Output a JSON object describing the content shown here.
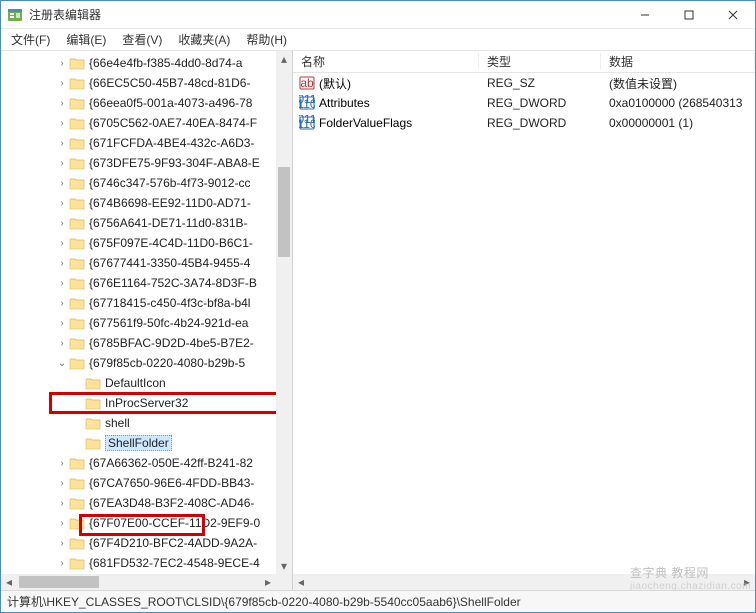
{
  "window": {
    "title": "注册表编辑器"
  },
  "menubar": {
    "file": "文件(F)",
    "edit": "编辑(E)",
    "view": "查看(V)",
    "favorites": "收藏夹(A)",
    "help": "帮助(H)"
  },
  "tree": {
    "items": [
      {
        "indent": 0,
        "exp": ">",
        "label": "{66e4e4fb-f385-4dd0-8d74-a"
      },
      {
        "indent": 0,
        "exp": ">",
        "label": "{66EC5C50-45B7-48cd-81D6-"
      },
      {
        "indent": 0,
        "exp": ">",
        "label": "{66eea0f5-001a-4073-a496-78"
      },
      {
        "indent": 0,
        "exp": ">",
        "label": "{6705C562-0AE7-40EA-8474-F"
      },
      {
        "indent": 0,
        "exp": ">",
        "label": "{671FCFDA-4BE4-432c-A6D3-"
      },
      {
        "indent": 0,
        "exp": ">",
        "label": "{673DFE75-9F93-304F-ABA8-E"
      },
      {
        "indent": 0,
        "exp": ">",
        "label": "{6746c347-576b-4f73-9012-cc"
      },
      {
        "indent": 0,
        "exp": ">",
        "label": "{674B6698-EE92-11D0-AD71-"
      },
      {
        "indent": 0,
        "exp": ">",
        "label": "{6756A641-DE71-11d0-831B-"
      },
      {
        "indent": 0,
        "exp": ">",
        "label": "{675F097E-4C4D-11D0-B6C1-"
      },
      {
        "indent": 0,
        "exp": ">",
        "label": "{67677441-3350-45B4-9455-4"
      },
      {
        "indent": 0,
        "exp": ">",
        "label": "{676E1164-752C-3A74-8D3F-B"
      },
      {
        "indent": 0,
        "exp": ">",
        "label": "{67718415-c450-4f3c-bf8a-b4l"
      },
      {
        "indent": 0,
        "exp": ">",
        "label": "{677561f9-50fc-4b24-921d-ea"
      },
      {
        "indent": 0,
        "exp": ">",
        "label": "{6785BFAC-9D2D-4be5-B7E2-"
      },
      {
        "indent": 0,
        "exp": "v",
        "label": "{679f85cb-0220-4080-b29b-5"
      },
      {
        "indent": 1,
        "exp": "",
        "label": "DefaultIcon"
      },
      {
        "indent": 1,
        "exp": "",
        "label": "InProcServer32"
      },
      {
        "indent": 1,
        "exp": "",
        "label": "shell"
      },
      {
        "indent": 1,
        "exp": "",
        "label": "ShellFolder",
        "selected": true
      },
      {
        "indent": 0,
        "exp": ">",
        "label": "{67A66362-050E-42ff-B241-82"
      },
      {
        "indent": 0,
        "exp": ">",
        "label": "{67CA7650-96E6-4FDD-BB43-"
      },
      {
        "indent": 0,
        "exp": ">",
        "label": "{67EA3D48-B3F2-408C-AD46-"
      },
      {
        "indent": 0,
        "exp": ">",
        "label": "{67F07E00-CCEF-11D2-9EF9-0"
      },
      {
        "indent": 0,
        "exp": ">",
        "label": "{67F4D210-BFC2-4ADD-9A2A-"
      },
      {
        "indent": 0,
        "exp": ">",
        "label": "{681FD532-7EC2-4548-9ECE-4"
      }
    ]
  },
  "list": {
    "columns": {
      "name": "名称",
      "type": "类型",
      "data": "数据"
    },
    "rows": [
      {
        "icon": "string",
        "name": "(默认)",
        "type": "REG_SZ",
        "data": "(数值未设置)"
      },
      {
        "icon": "binary",
        "name": "Attributes",
        "type": "REG_DWORD",
        "data": "0xa0100000 (268540313"
      },
      {
        "icon": "binary",
        "name": "FolderValueFlags",
        "type": "REG_DWORD",
        "data": "0x00000001 (1)"
      }
    ]
  },
  "statusbar": {
    "path": "计算机\\HKEY_CLASSES_ROOT\\CLSID\\{679f85cb-0220-4080-b29b-5540cc05aab6}\\ShellFolder"
  },
  "watermark": {
    "line1": "查字典  教程网",
    "line2": "jiaocheng.chazidian.com"
  }
}
